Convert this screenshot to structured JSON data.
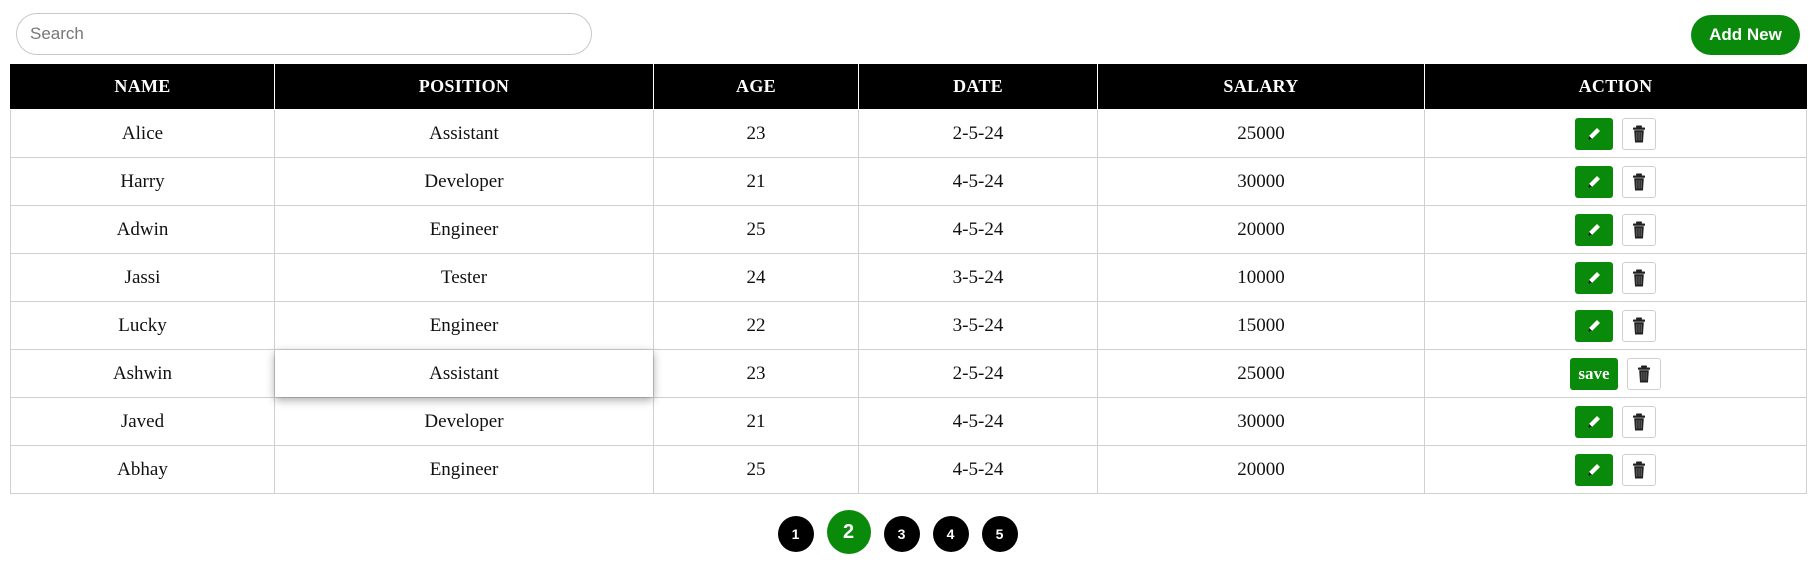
{
  "search": {
    "placeholder": "Search",
    "value": ""
  },
  "toolbar": {
    "add_label": "Add New"
  },
  "table": {
    "columns": [
      "NAME",
      "POSITION",
      "AGE",
      "DATE",
      "SALARY",
      "ACTION"
    ],
    "rows": [
      {
        "name": "Alice",
        "position": "Assistant",
        "age": "23",
        "date": "2-5-24",
        "salary": "25000",
        "editing": false
      },
      {
        "name": "Harry",
        "position": "Developer",
        "age": "21",
        "date": "4-5-24",
        "salary": "30000",
        "editing": false
      },
      {
        "name": "Adwin",
        "position": "Engineer",
        "age": "25",
        "date": "4-5-24",
        "salary": "20000",
        "editing": false
      },
      {
        "name": "Jassi",
        "position": "Tester",
        "age": "24",
        "date": "3-5-24",
        "salary": "10000",
        "editing": false
      },
      {
        "name": "Lucky",
        "position": "Engineer",
        "age": "22",
        "date": "3-5-24",
        "salary": "15000",
        "editing": false
      },
      {
        "name": "Ashwin",
        "position": "Assistant",
        "age": "23",
        "date": "2-5-24",
        "salary": "25000",
        "editing": true
      },
      {
        "name": "Javed",
        "position": "Developer",
        "age": "21",
        "date": "4-5-24",
        "salary": "30000",
        "editing": false
      },
      {
        "name": "Abhay",
        "position": "Engineer",
        "age": "25",
        "date": "4-5-24",
        "salary": "20000",
        "editing": false
      }
    ],
    "save_label": "save",
    "edit_icon": "pencil-icon",
    "delete_icon": "trash-icon"
  },
  "pagination": {
    "pages": [
      "1",
      "2",
      "3",
      "4",
      "5"
    ],
    "current": "2"
  },
  "colors": {
    "accent": "#0a8a0a",
    "header_bg": "#000000"
  }
}
